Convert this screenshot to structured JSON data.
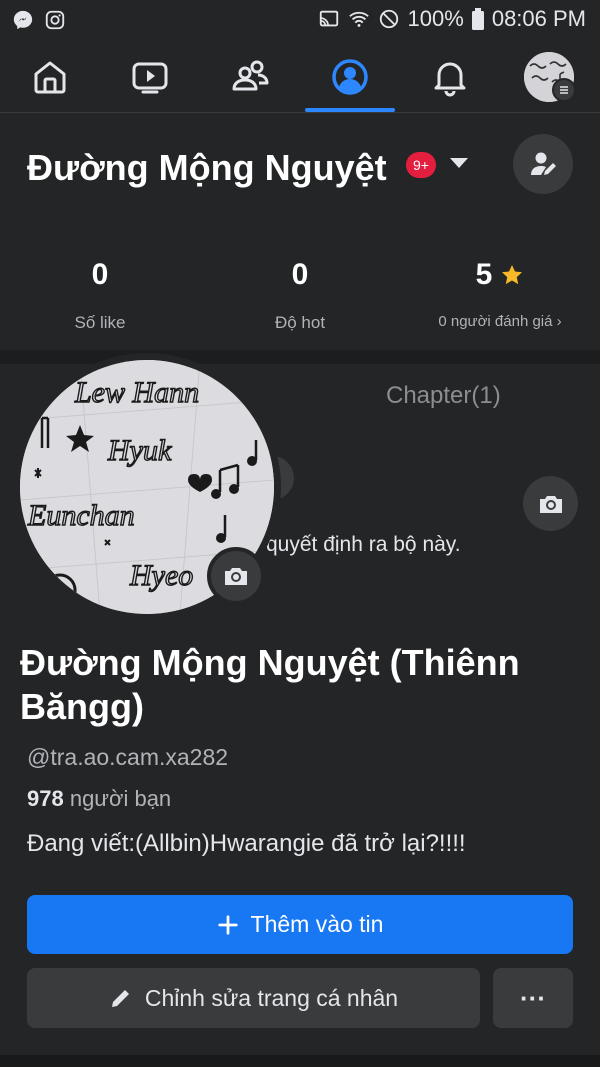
{
  "status_bar": {
    "battery": "100%",
    "time": "08:06 PM",
    "left_icons": [
      "messenger-icon",
      "instagram-icon"
    ],
    "right_icons": [
      "cast-icon",
      "wifi-icon",
      "dnd-icon",
      "battery-icon"
    ]
  },
  "top_nav": {
    "items": [
      "home-icon",
      "watch-icon",
      "friends-icon",
      "profile-icon",
      "notifications-icon",
      "avatar"
    ],
    "active": "profile-icon"
  },
  "header": {
    "name": "Đường Mộng Nguyệt",
    "badge": "9+"
  },
  "stats": [
    {
      "value": "0",
      "label": "Số like"
    },
    {
      "value": "0",
      "label": "Độ hot"
    },
    {
      "value": "5",
      "label": "0 người đánh giá ›"
    }
  ],
  "cover": {
    "tab_label": "Chapter(1)",
    "text": "quyết định ra bộ này."
  },
  "avatar_art_words": [
    "Lew Hann",
    "Hyuk",
    "Eunchan",
    "Hyeo"
  ],
  "profile": {
    "full_name": "Đường Mộng Nguyệt (Thiênn Băngg)",
    "handle": "@tra.ao.cam.xa282",
    "friends_count": "978",
    "friends_label": " người bạn",
    "writing": "Đang viết:(Allbin)Hwarangie đã trở lại?!!!!"
  },
  "buttons": {
    "add_story": "Thêm vào tin",
    "edit_profile": "Chỉnh sửa trang cá nhân",
    "more": "···"
  },
  "colors": {
    "accent": "#1877f2",
    "active_nav": "#2d88ff",
    "badge_red": "#e41e3f",
    "star": "#f7b928"
  }
}
